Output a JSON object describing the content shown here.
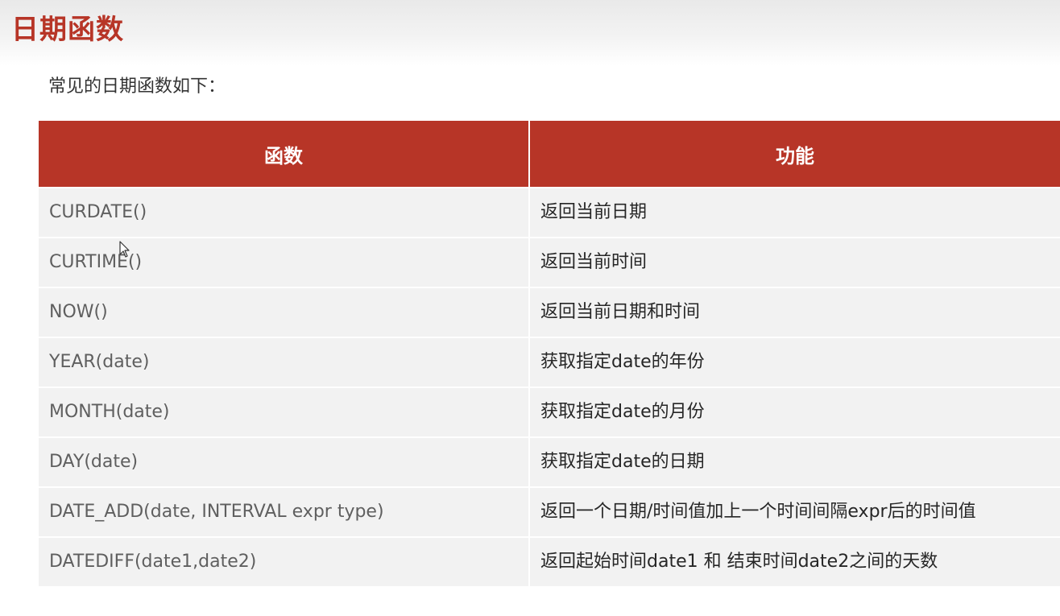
{
  "page": {
    "title": "日期函数",
    "intro": "常见的日期函数如下："
  },
  "table": {
    "headers": [
      "函数",
      "功能"
    ],
    "rows": [
      {
        "function": "CURDATE()",
        "description": "返回当前日期"
      },
      {
        "function": "CURTIME()",
        "description": "返回当前时间"
      },
      {
        "function": "NOW()",
        "description": "返回当前日期和时间"
      },
      {
        "function": "YEAR(date)",
        "description": "获取指定date的年份"
      },
      {
        "function": "MONTH(date)",
        "description": "获取指定date的月份"
      },
      {
        "function": "DAY(date)",
        "description": "获取指定date的日期"
      },
      {
        "function": "DATE_ADD(date, INTERVAL expr  type)",
        "description": "返回一个日期/时间值加上一个时间间隔expr后的时间值"
      },
      {
        "function": "DATEDIFF(date1,date2)",
        "description": "返回起始时间date1 和 结束时间date2之间的天数"
      }
    ]
  },
  "colors": {
    "accent": "#b73527",
    "header_text": "#ffffff",
    "row_background": "#f2f2f2",
    "function_text": "#5f5f5f",
    "description_text": "#262626"
  },
  "icons": {
    "cursor": "mouse-pointer-icon"
  }
}
